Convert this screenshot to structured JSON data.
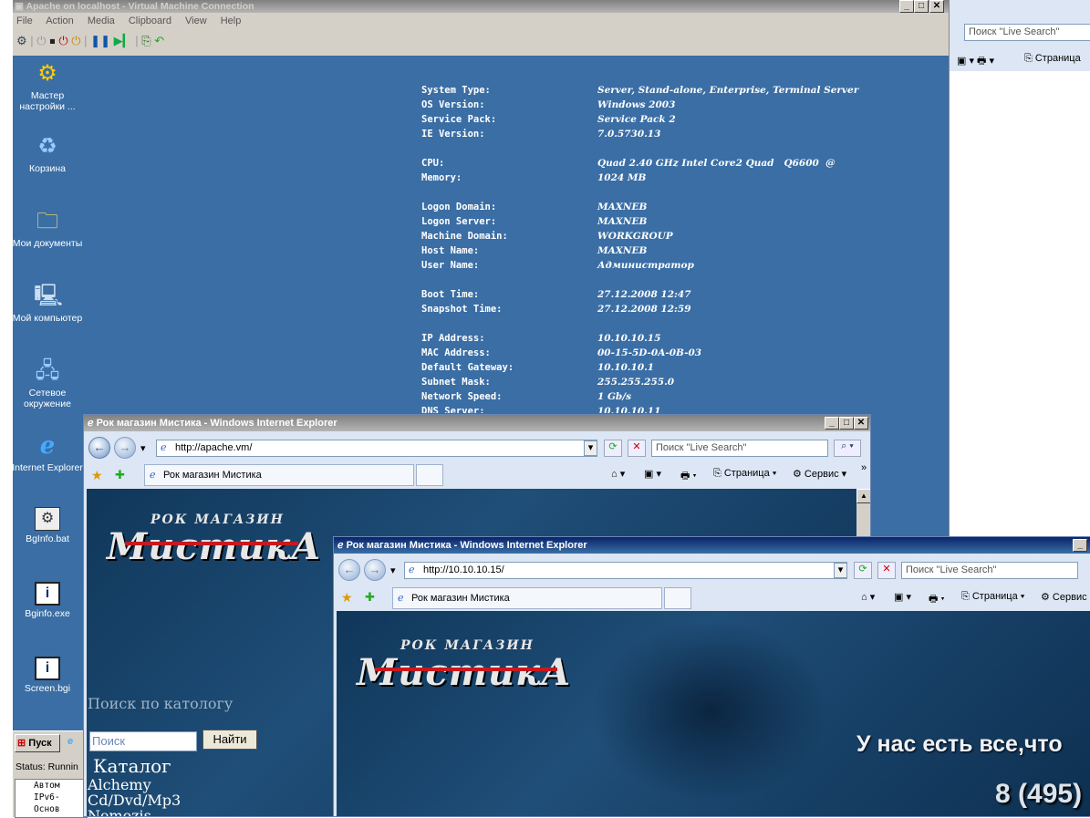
{
  "vm_window": {
    "title": "Apache on localhost - Virtual Machine Connection",
    "menu": [
      "File",
      "Action",
      "Media",
      "Clipboard",
      "View",
      "Help"
    ]
  },
  "right_panel": {
    "search_placeholder": "Поиск \"Live Search\"",
    "page_label": "Страница"
  },
  "desktop_icons": [
    {
      "label": "Мастер настройки ...",
      "icon": "wizard-icon"
    },
    {
      "label": "Корзина",
      "icon": "recycle-bin-icon"
    },
    {
      "label": "Мои документы",
      "icon": "my-documents-icon"
    },
    {
      "label": "Мой компьютер",
      "icon": "my-computer-icon"
    },
    {
      "label": "Сетевое окружение",
      "icon": "network-icon"
    },
    {
      "label": "Internet Explorer",
      "icon": "ie-icon"
    },
    {
      "label": "BgInfo.bat",
      "icon": "bat-file-icon"
    },
    {
      "label": "Bginfo.exe",
      "icon": "exe-file-icon"
    },
    {
      "label": "Screen.bgi",
      "icon": "bgi-file-icon"
    }
  ],
  "sysinfo": [
    {
      "k": "System Type:",
      "v": "Server, Stand-alone, Enterprise, Terminal Server"
    },
    {
      "k": "OS Version:",
      "v": "Windows 2003"
    },
    {
      "k": "Service Pack:",
      "v": "Service Pack 2"
    },
    {
      "k": "IE Version:",
      "v": "7.0.5730.13"
    },
    {
      "k": "",
      "v": ""
    },
    {
      "k": "CPU:",
      "v": "Quad 2.40 GHz Intel Core2 Quad   Q6600  @"
    },
    {
      "k": "Memory:",
      "v": "1024 MB"
    },
    {
      "k": "",
      "v": ""
    },
    {
      "k": "Logon Domain:",
      "v": "MAXNEB"
    },
    {
      "k": "Logon Server:",
      "v": "MAXNEB"
    },
    {
      "k": "Machine Domain:",
      "v": "WORKGROUP"
    },
    {
      "k": "Host Name:",
      "v": "MAXNEB"
    },
    {
      "k": "User Name:",
      "v": "Администратор"
    },
    {
      "k": "",
      "v": ""
    },
    {
      "k": "Boot Time:",
      "v": "27.12.2008 12:47"
    },
    {
      "k": "Snapshot Time:",
      "v": "27.12.2008 12:59"
    },
    {
      "k": "",
      "v": ""
    },
    {
      "k": "IP Address:",
      "v": "10.10.10.15"
    },
    {
      "k": "MAC Address:",
      "v": "00-15-5D-0A-0B-03"
    },
    {
      "k": "Default Gateway:",
      "v": "10.10.10.1"
    },
    {
      "k": "Subnet Mask:",
      "v": "255.255.255.0"
    },
    {
      "k": "Network Speed:",
      "v": "1 Gb/s"
    },
    {
      "k": "DNS Server:",
      "v": "10.10.10.11"
    }
  ],
  "taskbar": {
    "start_label": "Пуск",
    "status_text": "Status: Runnin",
    "list_items": [
      "Автом",
      "IPv6-",
      "Основ"
    ]
  },
  "ie1": {
    "title": "Рок магазин Мистика - Windows Internet Explorer",
    "url": "http://apache.vm/",
    "search_placeholder": "Поиск \"Live Search\"",
    "tab_label": "Рок магазин Мистика",
    "page_label": "Страница",
    "service_label": "Сервис",
    "site": {
      "logo_small": "РОК МАГАЗИН",
      "logo_big": "МистикА",
      "search_heading": "Поиск по катологу",
      "search_placeholder": "Поиск",
      "search_button": "Найти",
      "catalog_heading": "Каталог",
      "catalog_items": [
        "Alchemy",
        "Cd/Dvd/Mp3",
        "Nemezis"
      ]
    }
  },
  "ie2": {
    "title": "Рок магазин Мистика - Windows Internet Explorer",
    "url": "http://10.10.10.15/",
    "search_placeholder": "Поиск \"Live Search\"",
    "tab_label": "Рок магазин Мистика",
    "page_label": "Страница",
    "service_label": "Сервис",
    "site": {
      "logo_small": "РОК МАГАЗИН",
      "logo_big": "МистикА",
      "tagline": "У нас есть все,что",
      "phone": "8 (495)"
    }
  }
}
